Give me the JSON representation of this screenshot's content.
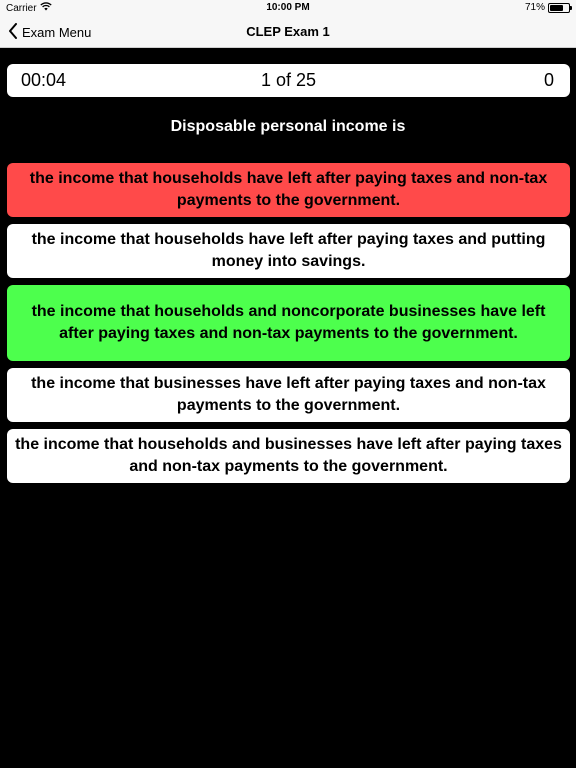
{
  "status_bar": {
    "carrier": "Carrier",
    "time": "10:00 PM",
    "battery": "71%",
    "battery_level": 0.71,
    "wifi_icon": "wifi-icon"
  },
  "nav": {
    "back_label": "Exam Menu",
    "title": "CLEP Exam 1"
  },
  "scorebar": {
    "timer": "00:04",
    "progress": "1 of 25",
    "score": "0"
  },
  "question": {
    "text": "Disposable personal income is"
  },
  "answers": [
    {
      "text": "the income that households have left after paying taxes and non-tax payments to the government.",
      "state": "wrong",
      "color": "#ff4a4a"
    },
    {
      "text": "the income that households have left after paying taxes and putting money into savings.",
      "state": "neutral",
      "color": "#ffffff"
    },
    {
      "text": "the income that households and noncorporate businesses have left after paying taxes and non-tax payments to the government.",
      "state": "correct",
      "color": "#4dff4d"
    },
    {
      "text": "the income that businesses have left after paying taxes and non-tax payments to the government.",
      "state": "neutral",
      "color": "#ffffff"
    },
    {
      "text": "the income that households and businesses have left after paying taxes and non-tax payments to the government.",
      "state": "neutral",
      "color": "#ffffff"
    }
  ]
}
